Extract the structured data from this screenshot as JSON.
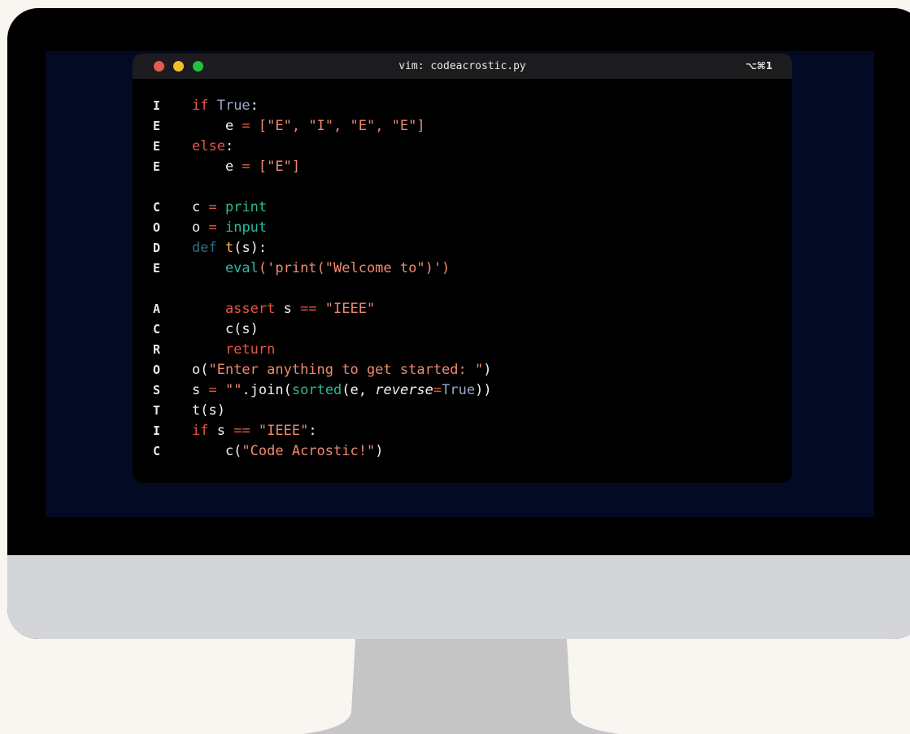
{
  "window": {
    "title": "vim: codeacrostic.py",
    "shortcut": "⌥⌘1"
  },
  "lines": [
    {
      "letter": "I",
      "tokens": [
        [
          "kw",
          "if "
        ],
        [
          "boolc",
          "True"
        ],
        [
          "id",
          ":"
        ]
      ]
    },
    {
      "letter": "E",
      "tokens": [
        [
          "id",
          "    e "
        ],
        [
          "op",
          "= "
        ],
        [
          "str",
          "[\"E\", \"I\", \"E\", \"E\"]"
        ]
      ]
    },
    {
      "letter": "E",
      "tokens": [
        [
          "kw",
          "else"
        ],
        [
          "id",
          ":"
        ]
      ]
    },
    {
      "letter": "E",
      "tokens": [
        [
          "id",
          "    e "
        ],
        [
          "op",
          "= "
        ],
        [
          "str",
          "[\"E\"]"
        ]
      ]
    },
    {
      "letter": "",
      "tokens": []
    },
    {
      "letter": "C",
      "tokens": [
        [
          "id",
          "c "
        ],
        [
          "op",
          "= "
        ],
        [
          "bi",
          "print"
        ]
      ]
    },
    {
      "letter": "O",
      "tokens": [
        [
          "id",
          "o "
        ],
        [
          "op",
          "= "
        ],
        [
          "bi",
          "input"
        ]
      ]
    },
    {
      "letter": "D",
      "tokens": [
        [
          "kwd",
          "def "
        ],
        [
          "fn",
          "t"
        ],
        [
          "id",
          "(s):"
        ]
      ]
    },
    {
      "letter": "E",
      "tokens": [
        [
          "bi",
          "    eval"
        ],
        [
          "str",
          "('print(\"Welcome to\")')"
        ]
      ]
    },
    {
      "letter": "",
      "tokens": []
    },
    {
      "letter": "A",
      "tokens": [
        [
          "kw",
          "    assert "
        ],
        [
          "id",
          "s "
        ],
        [
          "op",
          "== "
        ],
        [
          "str",
          "\"IEEE\""
        ]
      ]
    },
    {
      "letter": "C",
      "tokens": [
        [
          "id",
          "    c(s)"
        ]
      ]
    },
    {
      "letter": "R",
      "tokens": [
        [
          "kw",
          "    return"
        ]
      ]
    },
    {
      "letter": "O",
      "tokens": [
        [
          "id",
          "o("
        ],
        [
          "str",
          "\"Enter anything to get started: \""
        ],
        [
          "id",
          ")"
        ]
      ]
    },
    {
      "letter": "S",
      "tokens": [
        [
          "id",
          "s "
        ],
        [
          "op",
          "= "
        ],
        [
          "str",
          "\"\""
        ],
        [
          "id",
          ".join("
        ],
        [
          "bi",
          "sorted"
        ],
        [
          "id",
          "(e, "
        ],
        [
          "it",
          "reverse"
        ],
        [
          "op",
          "="
        ],
        [
          "boolc",
          "True"
        ],
        [
          "id",
          "))"
        ]
      ]
    },
    {
      "letter": "T",
      "tokens": [
        [
          "id",
          "t(s)"
        ]
      ]
    },
    {
      "letter": "I",
      "tokens": [
        [
          "kw",
          "if "
        ],
        [
          "id",
          "s "
        ],
        [
          "op",
          "== "
        ],
        [
          "str",
          "\"IEEE\""
        ],
        [
          "id",
          ":"
        ]
      ]
    },
    {
      "letter": "C",
      "tokens": [
        [
          "id",
          "    c("
        ],
        [
          "str",
          "\"Code Acrostic!\""
        ],
        [
          "id",
          ")"
        ]
      ]
    }
  ]
}
